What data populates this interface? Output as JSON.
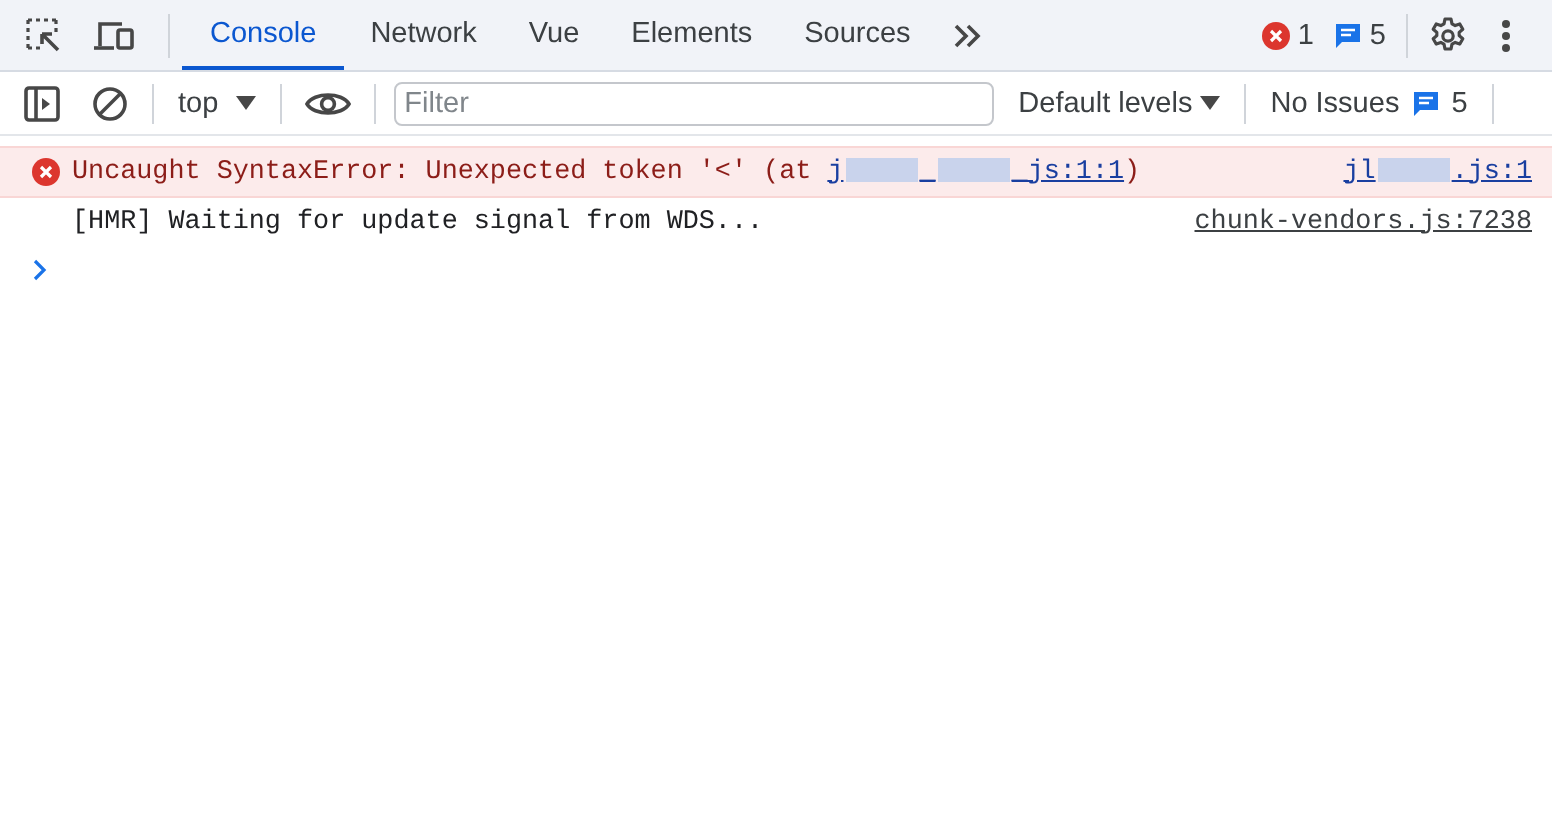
{
  "tabs": [
    {
      "label": "Console",
      "selected": true
    },
    {
      "label": "Network",
      "selected": false
    },
    {
      "label": "Vue",
      "selected": false
    },
    {
      "label": "Elements",
      "selected": false
    },
    {
      "label": "Sources",
      "selected": false
    }
  ],
  "counts": {
    "errors": "1",
    "messages": "5"
  },
  "toolbar": {
    "context": "top",
    "filter": {
      "placeholder": "Filter"
    },
    "levels": "Default levels",
    "issues": {
      "label": "No Issues",
      "count": "5"
    }
  },
  "messages": [
    {
      "kind": "error",
      "text_before": "Uncaught SyntaxError: Unexpected token '<' (at ",
      "link": [
        "j",
        "_",
        "_js:1:1"
      ],
      "text_after": ")",
      "source": [
        "jl",
        ".js:1"
      ]
    },
    {
      "kind": "log",
      "text_before": "[HMR] Waiting for update signal from WDS...",
      "source": [
        "chunk-vendors.js:7238"
      ]
    }
  ]
}
